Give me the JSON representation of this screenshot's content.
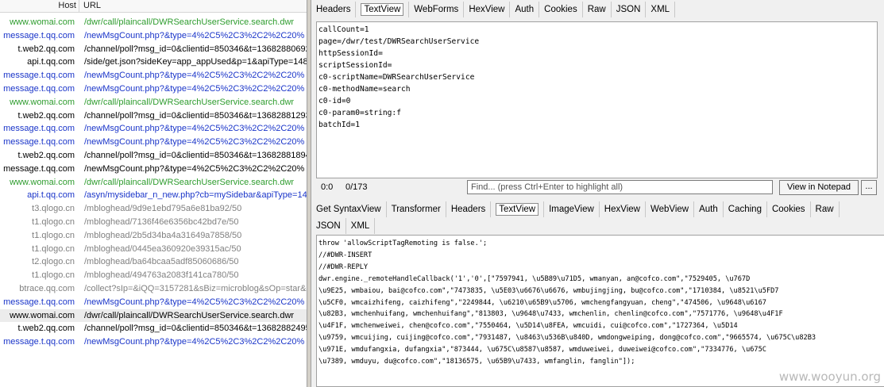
{
  "session_list": {
    "columns": {
      "host": "Host",
      "url": "URL"
    },
    "rows": [
      {
        "host": "www.womai.com",
        "url": "/dwr/call/plaincall/DWRSearchUserService.search.dwr",
        "color": "#2e9c2e"
      },
      {
        "host": "message.t.qq.com",
        "url": "/newMsgCount.php?&type=4%2C5%2C3%2C2%2C20%",
        "color": "#1a35c9"
      },
      {
        "host": "t.web2.qq.com",
        "url": "/channel/poll?msg_id=0&clientid=850346&t=13682880692",
        "color": "#000000"
      },
      {
        "host": "api.t.qq.com",
        "url": "/side/get.json?sideKey=app_appUsed&p=1&apiType=148",
        "color": "#000000"
      },
      {
        "host": "message.t.qq.com",
        "url": "/newMsgCount.php?&type=4%2C5%2C3%2C2%2C20%",
        "color": "#1a35c9"
      },
      {
        "host": "message.t.qq.com",
        "url": "/newMsgCount.php?&type=4%2C5%2C3%2C2%2C20%",
        "color": "#1a35c9"
      },
      {
        "host": "www.womai.com",
        "url": "/dwr/call/plaincall/DWRSearchUserService.search.dwr",
        "color": "#2e9c2e"
      },
      {
        "host": "t.web2.qq.com",
        "url": "/channel/poll?msg_id=0&clientid=850346&t=13682881293",
        "color": "#000000"
      },
      {
        "host": "message.t.qq.com",
        "url": "/newMsgCount.php?&type=4%2C5%2C3%2C2%2C20%",
        "color": "#1a35c9"
      },
      {
        "host": "message.t.qq.com",
        "url": "/newMsgCount.php?&type=4%2C5%2C3%2C2%2C20%",
        "color": "#1a35c9"
      },
      {
        "host": "t.web2.qq.com",
        "url": "/channel/poll?msg_id=0&clientid=850346&t=13682881894",
        "color": "#000000"
      },
      {
        "host": "message.t.qq.com",
        "url": "/newMsgCount.php?&type=4%2C5%2C3%2C2%2C20%",
        "color": "#000000"
      },
      {
        "host": "www.womai.com",
        "url": "/dwr/call/plaincall/DWRSearchUserService.search.dwr",
        "color": "#2e9c2e"
      },
      {
        "host": "api.t.qq.com",
        "url": "/asyn/mysidebar_n_new.php?cb=mySidebar&apiType=14",
        "color": "#1a35c9"
      },
      {
        "host": "t3.qlogo.cn",
        "url": "/mbloghead/9d9e1ebd795a6e81ba92/50",
        "color": "#808080"
      },
      {
        "host": "t1.qlogo.cn",
        "url": "/mbloghead/7136f46e6356bc42bd7e/50",
        "color": "#808080"
      },
      {
        "host": "t1.qlogo.cn",
        "url": "/mbloghead/2b5d34ba4a31649a7858/50",
        "color": "#808080"
      },
      {
        "host": "t1.qlogo.cn",
        "url": "/mbloghead/0445ea360920e39315ac/50",
        "color": "#808080"
      },
      {
        "host": "t2.qlogo.cn",
        "url": "/mbloghead/ba64bcaa5adf85060686/50",
        "color": "#808080"
      },
      {
        "host": "t1.qlogo.cn",
        "url": "/mbloghead/494763a2083f141ca780/50",
        "color": "#808080"
      },
      {
        "host": "btrace.qq.com",
        "url": "/collect?sIp=&iQQ=3157281&sBiz=microblog&sOp=star&s",
        "color": "#808080"
      },
      {
        "host": "message.t.qq.com",
        "url": "/newMsgCount.php?&type=4%2C5%2C3%2C2%2C20%",
        "color": "#1a35c9"
      },
      {
        "host": "www.womai.com",
        "url": "/dwr/call/plaincall/DWRSearchUserService.search.dwr",
        "color": "#000000",
        "selected": true
      },
      {
        "host": "t.web2.qq.com",
        "url": "/channel/poll?msg_id=0&clientid=850346&t=13682882495",
        "color": "#000000"
      },
      {
        "host": "message.t.qq.com",
        "url": "/newMsgCount.php?&type=4%2C5%2C3%2C2%2C20%",
        "color": "#1a35c9"
      }
    ]
  },
  "request_tabs": [
    "Headers",
    "TextView",
    "WebForms",
    "HexView",
    "Auth",
    "Cookies",
    "Raw",
    "JSON",
    "XML"
  ],
  "request_active_tab": "TextView",
  "request_body": [
    "callCount=1",
    "page=/dwr/test/DWRSearchUserService",
    "httpSessionId=",
    "scriptSessionId=",
    "c0-scriptName=DWRSearchUserService",
    "c0-methodName=search",
    "c0-id=0",
    "c0-param0=string:f",
    "batchId=1"
  ],
  "status": {
    "position": "0:0",
    "count": "0/173",
    "find_placeholder": "Find... (press Ctrl+Enter to highlight all)",
    "notepad_button": "View in Notepad",
    "more_button": "..."
  },
  "response_tabs_row1": [
    "Get SyntaxView",
    "Transformer",
    "Headers",
    "TextView",
    "ImageView",
    "HexView",
    "WebView",
    "Auth",
    "Caching",
    "Cookies",
    "Raw"
  ],
  "response_tabs_row2": [
    "JSON",
    "XML"
  ],
  "response_active_tab": "TextView",
  "response_body": [
    "throw 'allowScriptTagRemoting is false.';",
    "//#DWR-INSERT",
    "//#DWR-REPLY",
    "dwr.engine._remoteHandleCallback('1','0',[\"7597941, \\u5B89\\u71D5, wmanyan, an@cofco.com\",\"7529405, \\u767D",
    "\\u9E25, wmbaiou, bai@cofco.com\",\"7473835, \\u5E03\\u6676\\u6676, wmbujingjing, bu@cofco.com\",\"1710384, \\u8521\\u5FD7",
    "\\u5CF0, wmcaizhifeng, caizhifeng\",\"2249844, \\u6210\\u65B9\\u5706, wmchengfangyuan, cheng\",\"474506, \\u9648\\u6167",
    "\\u82B3, wmchenhuifang, wmchenhuifang\",\"813803, \\u9648\\u7433, wmchenlin, chenlin@cofco.com\",\"7571776, \\u9648\\u4F1F",
    "\\u4F1F, wmchenweiwei, chen@cofco.com\",\"7550464, \\u5D14\\u8FEA, wmcuidi, cui@cofco.com\",\"1727364, \\u5D14",
    "\\u9759, wmcuijing, cuijing@cofco.com\",\"7931487, \\u8463\\u536B\\u840D, wmdongweiping, dong@cofco.com\",\"9665574, \\u675C\\u82B3",
    "\\u971E, wmdufangxia, dufangxia\",\"873444, \\u675C\\u8587\\u8587, wmduweiwei, duweiwei@cofco.com\",\"7334776, \\u675C",
    "\\u7389, wmduyu, du@cofco.com\",\"18136575, \\u65B9\\u7433, wmfanglin, fanglin\"]);"
  ],
  "watermark": "www.wooyun.org"
}
